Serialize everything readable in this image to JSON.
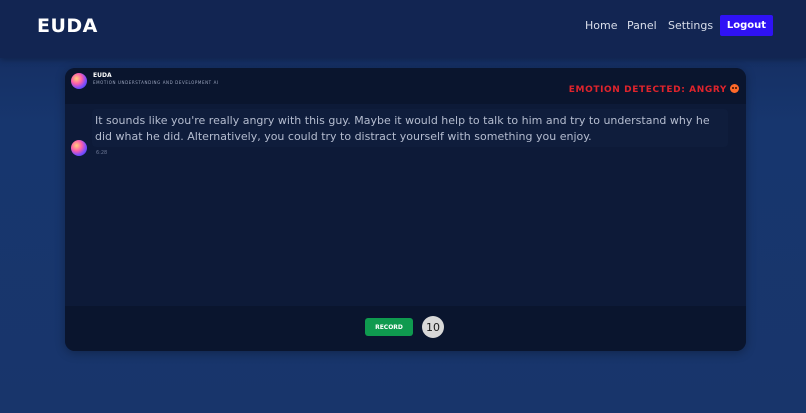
{
  "navbar": {
    "brand": "EUDA",
    "links": [
      {
        "label": "Home"
      },
      {
        "label": "Panel"
      },
      {
        "label": "Settings"
      }
    ],
    "logout_label": "Logout"
  },
  "chat": {
    "bot_name": "EUDA",
    "bot_subtitle": "EMOTION UNDERSTANDING AND DEVELOPMENT AI",
    "emotion_label": "EMOTION DETECTED: ANGRY",
    "emotion_icon": "angry-face-icon",
    "messages": [
      {
        "text": "It sounds like you're really angry with this guy. Maybe it would help to talk to him and try to understand why he did what he did. Alternatively, you could try to distract yourself with something you enjoy.",
        "time": "6:28"
      }
    ]
  },
  "footer": {
    "record_label": "RECORD",
    "timer_value": "10"
  },
  "colors": {
    "accent": "#2f12f5",
    "emotion": "#e0242c",
    "record": "#0f9a4f"
  }
}
